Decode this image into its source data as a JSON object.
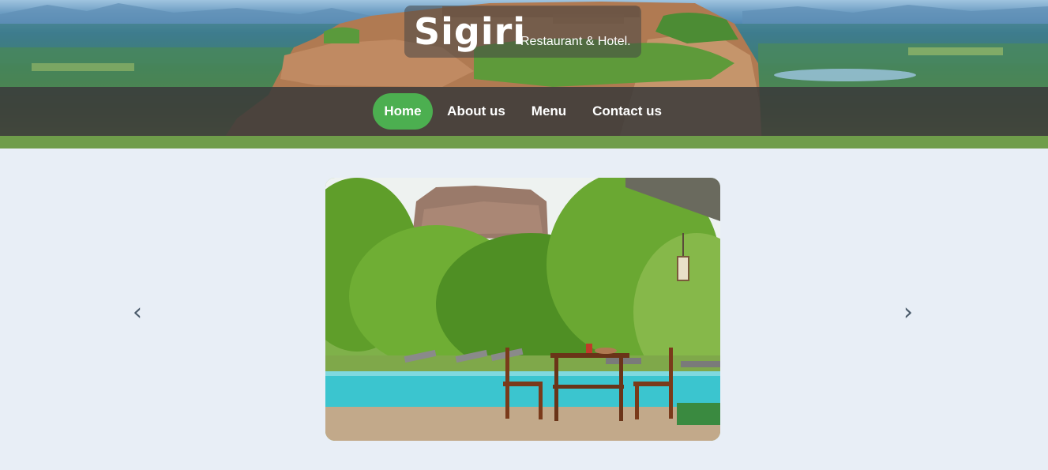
{
  "brand": {
    "title": "Sigiri",
    "subtitle": "Restaurant & Hotel."
  },
  "nav": {
    "items": [
      {
        "label": "Home",
        "active": true
      },
      {
        "label": "About us",
        "active": false
      },
      {
        "label": "Menu",
        "active": false
      },
      {
        "label": "Contact us",
        "active": false
      }
    ]
  },
  "carousel": {
    "prev_symbol": "‹",
    "next_symbol": "›"
  },
  "colors": {
    "nav_active": "#4caf50",
    "nav_bar": "#3a3a3a",
    "page_bg": "#e8eef6"
  }
}
